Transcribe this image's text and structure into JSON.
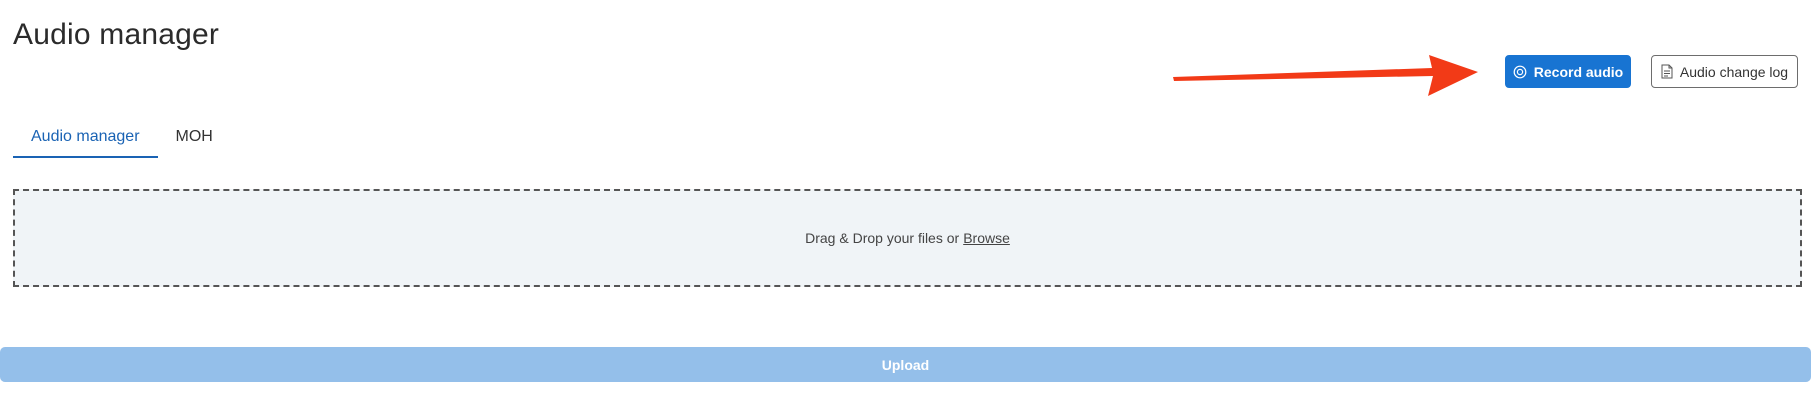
{
  "header": {
    "title": "Audio manager",
    "record_audio_label": "Record audio",
    "change_log_label": "Audio change log"
  },
  "tabs": [
    {
      "label": "Audio manager",
      "active": true
    },
    {
      "label": "MOH",
      "active": false
    }
  ],
  "dropzone": {
    "text": "Drag & Drop your files or",
    "browse_label": "Browse"
  },
  "upload": {
    "label": "Upload"
  },
  "icons": {
    "record": "record-icon",
    "document": "document-icon",
    "annotation": "red-arrow"
  },
  "colors": {
    "primary": "#1874d2",
    "active_tab": "#1a63b4",
    "upload_disabled": "#94bfea",
    "annotation_arrow": "#f23a17"
  }
}
